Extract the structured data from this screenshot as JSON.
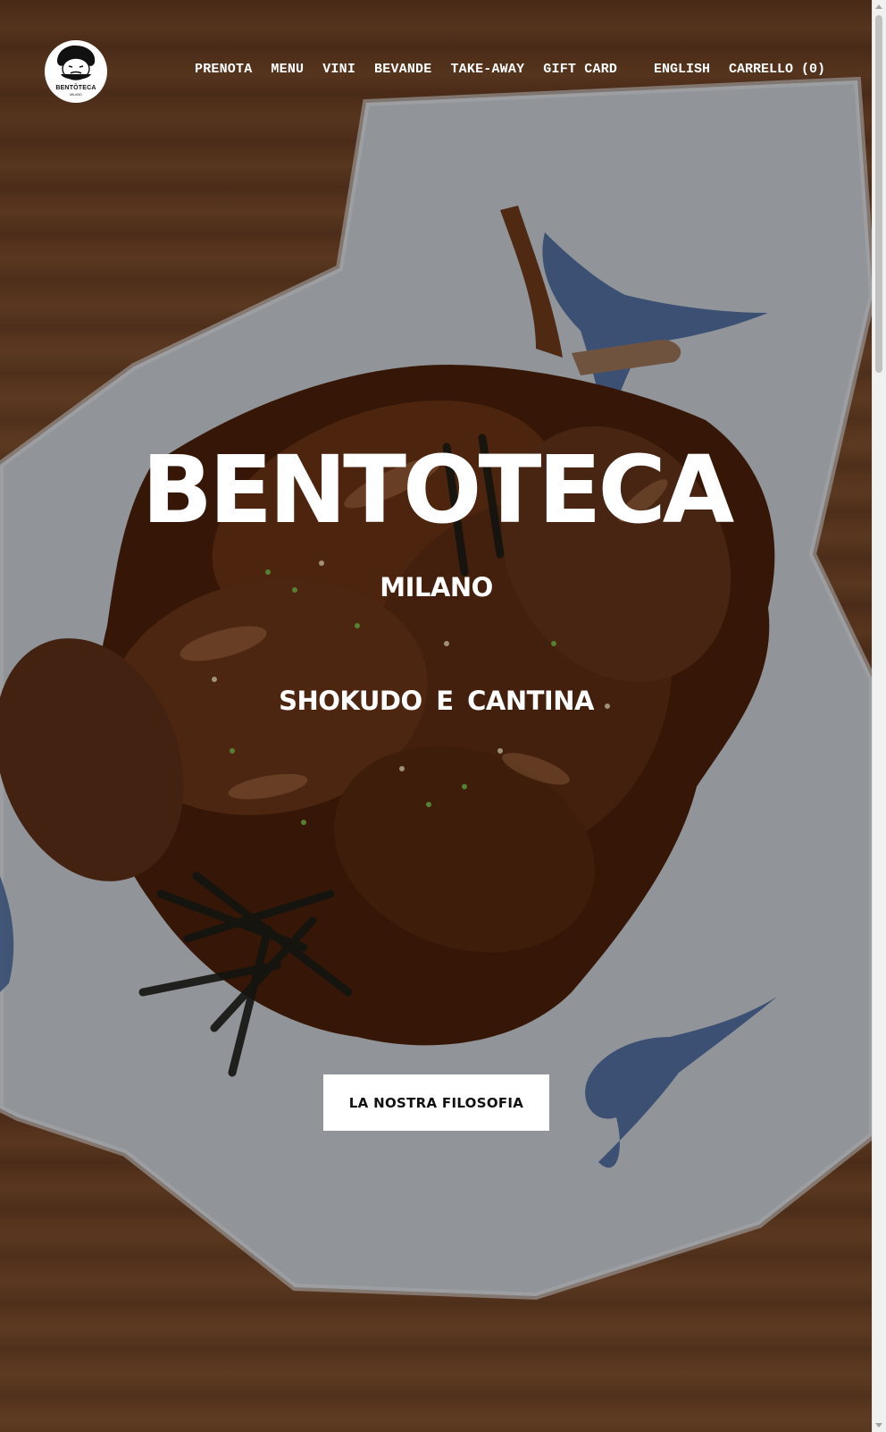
{
  "brand": {
    "logo_text": "BENTŌTECA",
    "logo_sub": "MILANO"
  },
  "nav": {
    "items": [
      {
        "label": "PRENOTA"
      },
      {
        "label": "MENU"
      },
      {
        "label": "VINI"
      },
      {
        "label": "BEVANDE"
      },
      {
        "label": "TAKE-AWAY"
      },
      {
        "label": "GIFT CARD"
      }
    ],
    "language": "ENGLISH",
    "cart": "CARRELLO (0)"
  },
  "hero": {
    "title": "BENTOTECA",
    "city": "MILANO",
    "tagline": "SHOKUDO E CANTINA",
    "cta_label": "LA NOSTRA FILOSOFIA",
    "background_image": "roasted-quail-on-plate"
  },
  "colors": {
    "text": "#ffffff",
    "button_bg": "#ffffff",
    "button_text": "#111111",
    "wood": "#6e4124",
    "plate": "#c7ccd3",
    "sauce": "#5a2a0e",
    "bird_blue": "#3d5f96"
  }
}
